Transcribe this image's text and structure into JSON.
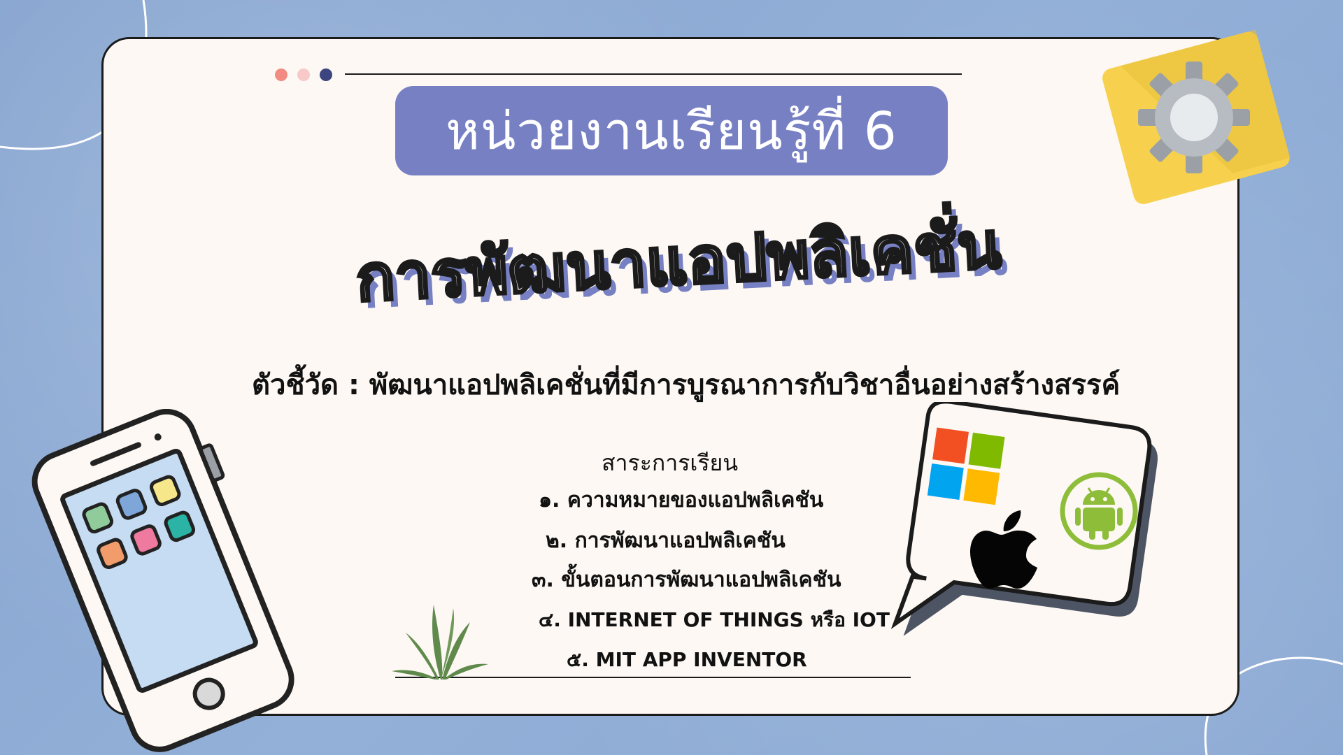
{
  "title": "หน่วยงานเรียนรู้ที่ 6",
  "subject": "การพัฒนาแอปพลิเคชั่น",
  "indicator": "ตัวชี้วัด : พัฒนาแอปพลิเคชั่นที่มีการบูรณาการกับวิชาอื่นอย่างสร้างสรรค์",
  "content": {
    "heading": "สาระการเรียน",
    "items": [
      "๑. ความหมายของแอปพลิเคชัน",
      "๒. การพัฒนาแอปพลิเคชัน",
      "๓. ขั้นตอนการพัฒนาแอปพลิเคชัน",
      "๔. INTERNET OF THINGS หรือ IOT",
      "๕. MIT APP INVENTOR"
    ]
  },
  "colors": {
    "background": "#8eaad3",
    "card": "#fdf8f3",
    "accent": "#7780c3",
    "outline": "#1b1b1b"
  },
  "icons": [
    "gear-icon",
    "smartphone-icon",
    "speech-bubble-icon",
    "windows-logo-icon",
    "apple-logo-icon",
    "android-logo-icon",
    "plant-icon"
  ]
}
